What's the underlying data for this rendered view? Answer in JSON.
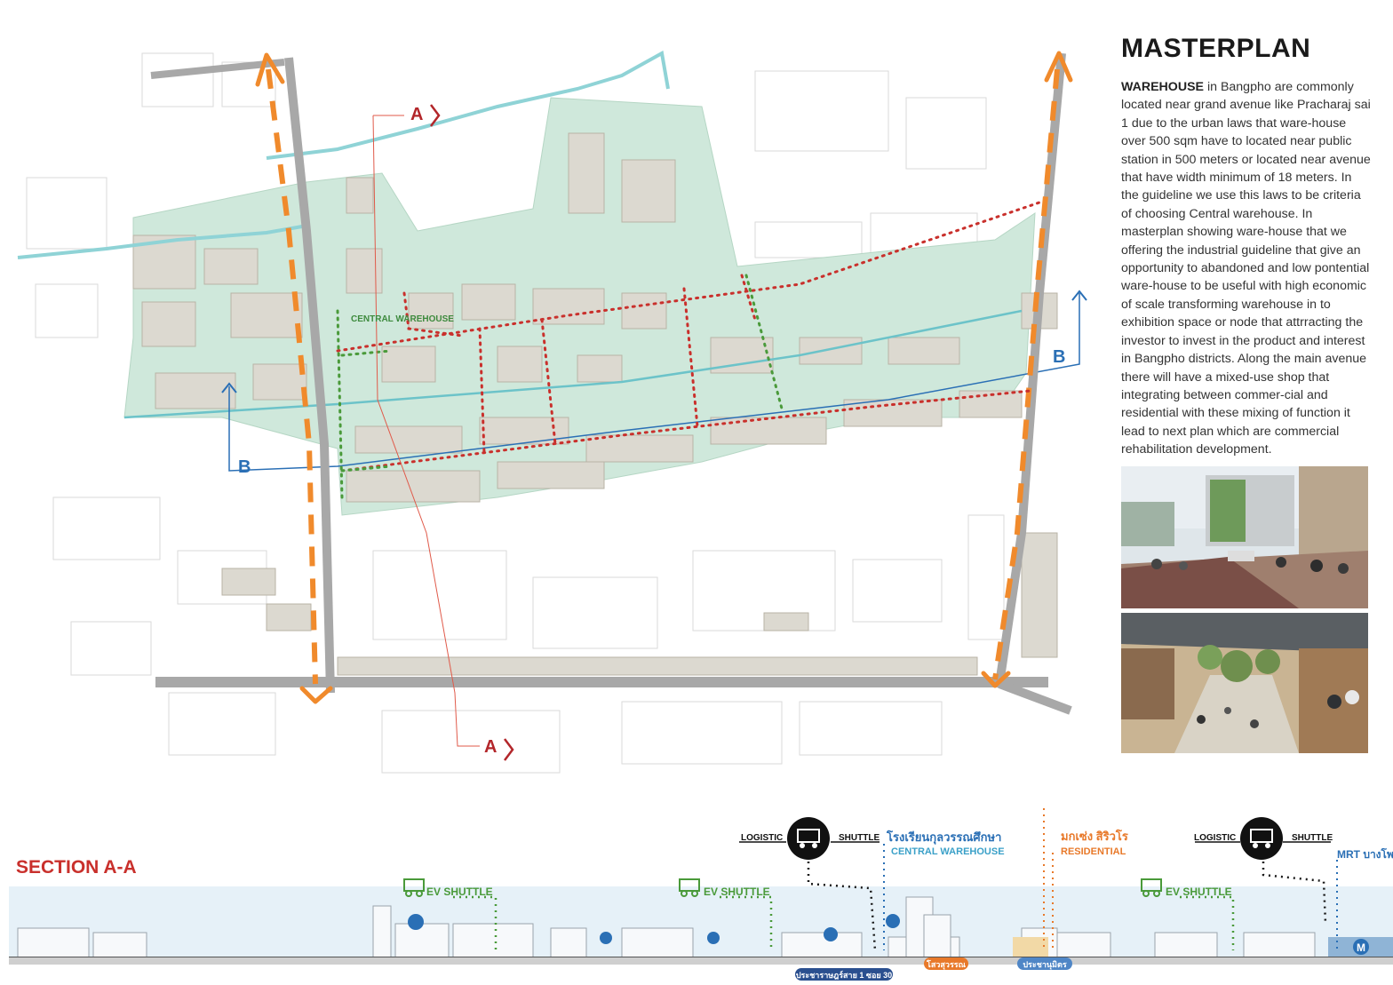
{
  "header": {
    "title": "MASTERPLAN",
    "intro_bold": "WAREHOUSE",
    "intro_text": " in Bangpho are commonly located near grand avenue like Pracharaj sai 1 due to the urban laws that ware-house over 500 sqm have to located near public station in 500 meters or located near avenue that have width minimum of 18 meters. In the guideline we use this laws to be criteria of choosing Central warehouse. In masterplan showing ware-house that we offering the industrial guideline that give an opportunity to abandoned and low pontential ware-house to be useful with high economic of scale transforming warehouse in to exhibition space or node that attrracting the investor to invest in the product and interest in Bangpho districts. Along the main avenue there will have a mixed-use shop that integrating between commer-cial and residential with these mixing of function it lead to next plan which are commercial rehabilitation development."
  },
  "map": {
    "central_label": "CENTRAL WAREHOUSE",
    "section_a_top": "A",
    "section_a_bottom": "A",
    "section_b_left": "B",
    "section_b_right": "B"
  },
  "section": {
    "title": "SECTION A-A",
    "logistic_1": "LOGISTIC",
    "shuttle_1": "SHUTTLE",
    "logistic_2": "LOGISTIC",
    "shuttle_2": "SHUTTLE",
    "school_thai": "โรงเรียนกุลวรรณศึกษา",
    "central_warehouse": "CENTRAL WAREHOUSE",
    "residential_thai": "มกเซ่ง สิริวโร",
    "residential": "RESIDENTIAL",
    "mrt": "MRT บางโพ",
    "ev_1": "EV SHUTTLE",
    "ev_2": "EV SHUTTLE",
    "ev_3": "EV SHUTTLE",
    "road_1": "ประชาราษฎร์สาย 1 ซอย 30",
    "road_2": "โสวสุวรรณ",
    "road_3": "ประชานุมิตร",
    "mrt_sign": "M"
  },
  "colors": {
    "block": "#cfe8db",
    "building": "#dcd9d0",
    "road": "#a8a8a8",
    "arrow": "#f08a2c",
    "canal": "#8fd3d6",
    "redpath": "#c9302c",
    "greenpath": "#4a9a3a",
    "blue": "#2a6fb5",
    "orange": "#e8792a"
  }
}
